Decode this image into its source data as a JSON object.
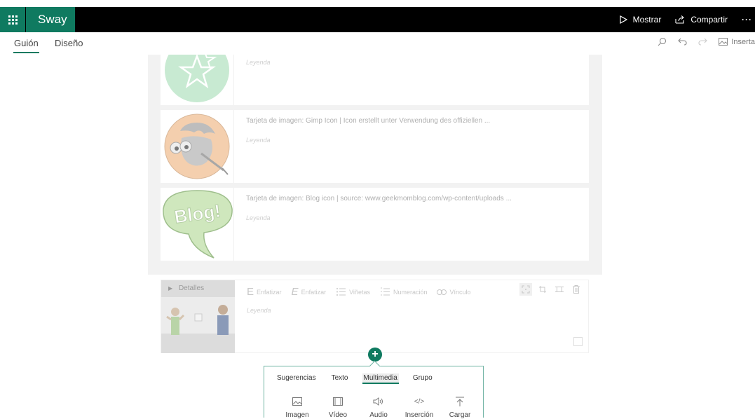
{
  "app": {
    "brand": "Sway",
    "top_actions": {
      "present_label": "Mostrar",
      "share_label": "Compartir",
      "more_label": "···"
    }
  },
  "tabs": [
    {
      "label": "Guión",
      "active": true
    },
    {
      "label": "Diseño",
      "active": false
    }
  ],
  "toolbar": {
    "insert_label": "Inserta"
  },
  "cards": [
    {
      "title": "",
      "caption": "Leyenda",
      "icon": "star-icon"
    },
    {
      "title": "Tarjeta de imagen: Gimp Icon | Icon erstellt unter Verwendung des offiziellen ...",
      "caption": "Leyenda",
      "icon": "gimp-icon"
    },
    {
      "title": "Tarjeta de imagen: Blog icon | source: www.geekmomblog.com/wp-content/uploads ...",
      "caption": "Leyenda",
      "icon": "blog-bubble-icon",
      "badge": "Blog!"
    }
  ],
  "detail_card": {
    "details_label": "Detalles",
    "caption": "Leyenda",
    "tools": [
      "Enfatizar",
      "Enfatizar",
      "Viñetas",
      "Numeración",
      "Vínculo"
    ]
  },
  "insert_panel": {
    "tabs": [
      {
        "label": "Sugerencias",
        "active": false
      },
      {
        "label": "Texto",
        "active": false
      },
      {
        "label": "Multimedia",
        "active": true
      },
      {
        "label": "Grupo",
        "active": false
      }
    ],
    "items": [
      {
        "label": "Imagen",
        "icon": "image-icon"
      },
      {
        "label": "Vídeo",
        "icon": "video-icon"
      },
      {
        "label": "Audio",
        "icon": "audio-icon"
      },
      {
        "label": "Inserción",
        "icon": "embed-icon"
      },
      {
        "label": "Cargar",
        "icon": "upload-icon"
      }
    ]
  },
  "colors": {
    "accent": "#0f7a60",
    "topbar": "#000000"
  }
}
